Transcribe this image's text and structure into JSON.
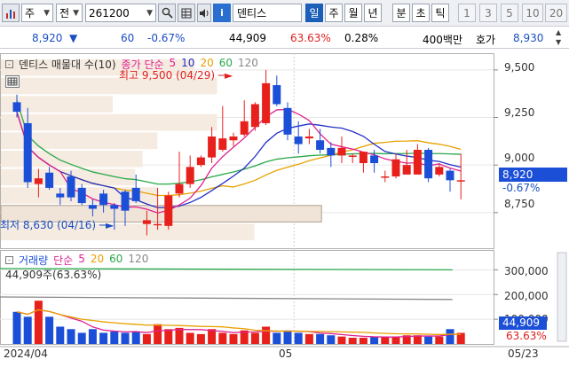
{
  "toolbar": {
    "chart_type_icon": "bar-chart-icon",
    "period_label": "주",
    "view_label": "전",
    "stock_code": "261200",
    "search_icon": "search-icon",
    "grid_icon": "grid-icon",
    "sound_icon": "speaker-icon",
    "info_icon": "stock-info-icon",
    "stock_name": "덴티스",
    "periods": [
      "일",
      "주",
      "월",
      "년",
      "분",
      "초",
      "틱"
    ],
    "active_period": "일",
    "intervals": [
      "1",
      "3",
      "5",
      "10",
      "20"
    ]
  },
  "infobar": {
    "price": "8,920",
    "change_arrow": "▼",
    "change": "60",
    "change_pct": "-0.67%",
    "volume": "44,909",
    "volume_ratio": "63.63%",
    "turnover": "0.28%",
    "trade_value": "400백만",
    "ask_label": "호가",
    "ask_price": "8,930"
  },
  "price_chart": {
    "legend_title": "덴티스 매물대 수(10)",
    "ma_label": "종가 단순",
    "ma_periods": [
      "5",
      "10",
      "20",
      "60",
      "120"
    ],
    "ma_colors": [
      "#e0208f",
      "#2330c8",
      "#e8a000",
      "#2aa84a",
      "#a0a0a0"
    ],
    "high_note": "최고 9,500 (04/29)",
    "low_note": "최저 8,630 (04/16)",
    "y_ticks": [
      "9,500",
      "9,250",
      "9,000",
      "8,750"
    ],
    "current_price_tag": "8,920",
    "current_change_tag": "-0.67%",
    "up_color": "#e8201c",
    "down_color": "#1c4fd8"
  },
  "volume_chart": {
    "legend_title": "거래량",
    "ma_label": "단순",
    "ma_periods": [
      "5",
      "20",
      "60",
      "120"
    ],
    "volume_note": "44,909주(63.63%)",
    "y_ticks": [
      "300,000",
      "200,000",
      "100,000"
    ],
    "current_volume_tag": "44,909",
    "current_ratio_tag": "63.63%"
  },
  "x_axis": {
    "labels": [
      "2024/04",
      "05",
      "05/23"
    ]
  },
  "chart_data": {
    "type": "candlestick",
    "price_ylim": [
      8600,
      9560
    ],
    "volume_ylim": [
      0,
      330000
    ],
    "candles": [
      {
        "o": 9330,
        "h": 9370,
        "l": 9250,
        "c": 9280
      },
      {
        "o": 9220,
        "h": 9300,
        "l": 8880,
        "c": 8910
      },
      {
        "o": 8900,
        "h": 8980,
        "l": 8830,
        "c": 8930
      },
      {
        "o": 8960,
        "h": 8990,
        "l": 8870,
        "c": 8880
      },
      {
        "o": 8850,
        "h": 8880,
        "l": 8790,
        "c": 8830
      },
      {
        "o": 8940,
        "h": 8970,
        "l": 8810,
        "c": 8830
      },
      {
        "o": 8880,
        "h": 8900,
        "l": 8790,
        "c": 8800
      },
      {
        "o": 8790,
        "h": 8820,
        "l": 8730,
        "c": 8770
      },
      {
        "o": 8850,
        "h": 8870,
        "l": 8750,
        "c": 8790
      },
      {
        "o": 8790,
        "h": 8800,
        "l": 8660,
        "c": 8770
      },
      {
        "o": 8860,
        "h": 8870,
        "l": 8680,
        "c": 8760
      },
      {
        "o": 8880,
        "h": 8950,
        "l": 8800,
        "c": 8810
      },
      {
        "o": 8690,
        "h": 8760,
        "l": 8630,
        "c": 8710
      },
      {
        "o": 8690,
        "h": 8880,
        "l": 8660,
        "c": 8690
      },
      {
        "o": 8680,
        "h": 8860,
        "l": 8660,
        "c": 8840
      },
      {
        "o": 8850,
        "h": 9070,
        "l": 8830,
        "c": 8900
      },
      {
        "o": 8900,
        "h": 9050,
        "l": 8880,
        "c": 8990
      },
      {
        "o": 9000,
        "h": 9050,
        "l": 8990,
        "c": 9040
      },
      {
        "o": 9040,
        "h": 9200,
        "l": 9010,
        "c": 9150
      },
      {
        "o": 9080,
        "h": 9310,
        "l": 9070,
        "c": 9140
      },
      {
        "o": 9130,
        "h": 9170,
        "l": 9100,
        "c": 9150
      },
      {
        "o": 9160,
        "h": 9340,
        "l": 9150,
        "c": 9230
      },
      {
        "o": 9200,
        "h": 9330,
        "l": 9180,
        "c": 9320
      },
      {
        "o": 9220,
        "h": 9500,
        "l": 9210,
        "c": 9430
      },
      {
        "o": 9420,
        "h": 9470,
        "l": 9310,
        "c": 9320
      },
      {
        "o": 9300,
        "h": 9330,
        "l": 9130,
        "c": 9160
      },
      {
        "o": 9150,
        "h": 9230,
        "l": 9060,
        "c": 9110
      },
      {
        "o": 9140,
        "h": 9190,
        "l": 9110,
        "c": 9150
      },
      {
        "o": 9130,
        "h": 9190,
        "l": 9060,
        "c": 9080
      },
      {
        "o": 9090,
        "h": 9120,
        "l": 8990,
        "c": 9050
      },
      {
        "o": 9050,
        "h": 9150,
        "l": 9010,
        "c": 9090
      },
      {
        "o": 9050,
        "h": 9060,
        "l": 9010,
        "c": 9050
      },
      {
        "o": 9010,
        "h": 9070,
        "l": 8960,
        "c": 9070
      },
      {
        "o": 9050,
        "h": 9080,
        "l": 8960,
        "c": 9010
      },
      {
        "o": 8940,
        "h": 8970,
        "l": 8910,
        "c": 8940
      },
      {
        "o": 8940,
        "h": 9060,
        "l": 8930,
        "c": 9030
      },
      {
        "o": 8950,
        "h": 9080,
        "l": 8960,
        "c": 9000
      },
      {
        "o": 8950,
        "h": 9110,
        "l": 8960,
        "c": 9080
      },
      {
        "o": 9080,
        "h": 9090,
        "l": 8910,
        "c": 8930
      },
      {
        "o": 8950,
        "h": 9010,
        "l": 8940,
        "c": 8990
      },
      {
        "o": 8970,
        "h": 8980,
        "l": 8860,
        "c": 8920
      },
      {
        "o": 8920,
        "h": 9060,
        "l": 8820,
        "c": 8920
      }
    ],
    "volumes": [
      130000,
      110000,
      175000,
      110000,
      70000,
      60000,
      45000,
      60000,
      45000,
      50000,
      45000,
      50000,
      40000,
      80000,
      60000,
      65000,
      45000,
      40000,
      60000,
      45000,
      40000,
      55000,
      45000,
      70000,
      45000,
      50000,
      45000,
      40000,
      40000,
      35000,
      30000,
      25000,
      25000,
      30000,
      30000,
      30000,
      35000,
      35000,
      30000,
      30000,
      60000,
      44909
    ],
    "volume_profile": [
      0.52,
      0.58,
      0.3,
      0.58,
      0.42,
      0.38,
      0.36,
      0.42,
      0.86,
      0.68
    ]
  }
}
